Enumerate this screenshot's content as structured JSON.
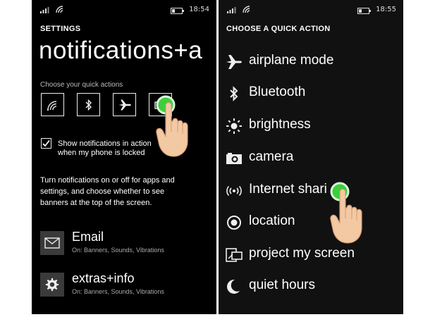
{
  "left": {
    "status": {
      "time": "18:54"
    },
    "header": "SETTINGS",
    "title": "notifications+a",
    "choose_label": "Choose your quick actions",
    "quick_actions": [
      {
        "icon": "wifi-icon"
      },
      {
        "icon": "bluetooth-icon"
      },
      {
        "icon": "airplane-icon"
      },
      {
        "icon": "quick-action-4-icon"
      }
    ],
    "lock_checkbox": {
      "checked": true,
      "label_line1": "Show notifications in action",
      "label_line2": "when my phone is locked"
    },
    "description": {
      "line1": "Turn notifications on or off for apps and",
      "line2": "settings, and choose whether to see",
      "line3": "banners at the top of the screen."
    },
    "apps": [
      {
        "name": "Email",
        "detail": "On: Banners, Sounds, Vibrations",
        "icon": "email-icon"
      },
      {
        "name": "extras+info",
        "detail": "On: Banners, Sounds, Vibrations",
        "icon": "gear-icon"
      }
    ]
  },
  "right": {
    "status": {
      "time": "18:55"
    },
    "header": "CHOOSE A QUICK ACTION",
    "actions": [
      {
        "label": "airplane mode",
        "icon": "airplane-icon"
      },
      {
        "label": "Bluetooth",
        "icon": "bluetooth-icon"
      },
      {
        "label": "brightness",
        "icon": "brightness-icon"
      },
      {
        "label": "camera",
        "icon": "camera-icon"
      },
      {
        "label": "Internet shari",
        "icon": "internet-sharing-icon"
      },
      {
        "label": "location",
        "icon": "location-icon"
      },
      {
        "label": "project my screen",
        "icon": "project-screen-icon"
      },
      {
        "label": "quiet hours",
        "icon": "quiet-hours-icon"
      }
    ]
  },
  "colors": {
    "touch_green": "#3ccf3c",
    "hand": "#f3c9a3",
    "tile": "#3a3a3a"
  }
}
